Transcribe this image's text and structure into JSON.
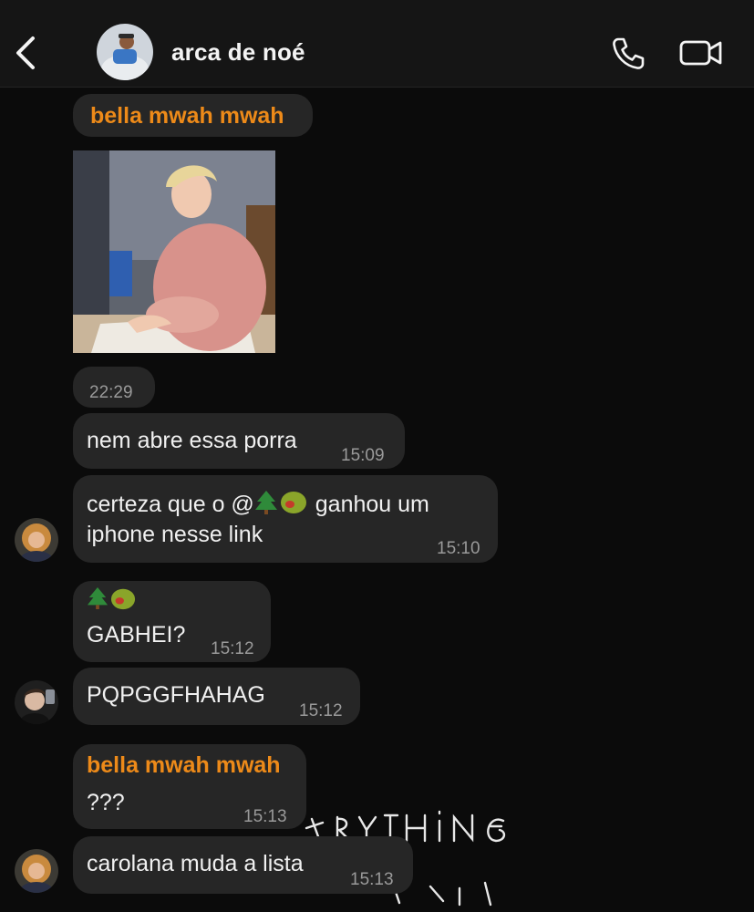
{
  "header": {
    "title": "arca de noé"
  },
  "messages": {
    "m1": {
      "sender": "bella mwah mwah"
    },
    "m2": {
      "time": "22:29"
    },
    "m3": {
      "text": "nem abre essa porra",
      "time": "15:09"
    },
    "m4": {
      "line1_pre": "certeza que o @",
      "line1_post": " ganhou um",
      "line2": "iphone nesse link",
      "time": "15:10"
    },
    "m5": {
      "text": "GABHEI?",
      "time": "15:12"
    },
    "m6": {
      "text": "PQPGGFHAHAG",
      "time": "15:12"
    },
    "m7": {
      "sender": "bella mwah mwah",
      "text": "???",
      "time": "15:13"
    },
    "m8": {
      "text": "carolana muda a lista",
      "time": "15:13"
    }
  },
  "colors": {
    "background": "#0b0b0b",
    "bubble": "#262626",
    "sender_name": "#ed8a19",
    "timestamp": "#9a9a9a"
  },
  "icons": [
    "back-chevron-icon",
    "phone-icon",
    "video-camera-icon",
    "tree-emoji",
    "olive-emoji"
  ]
}
